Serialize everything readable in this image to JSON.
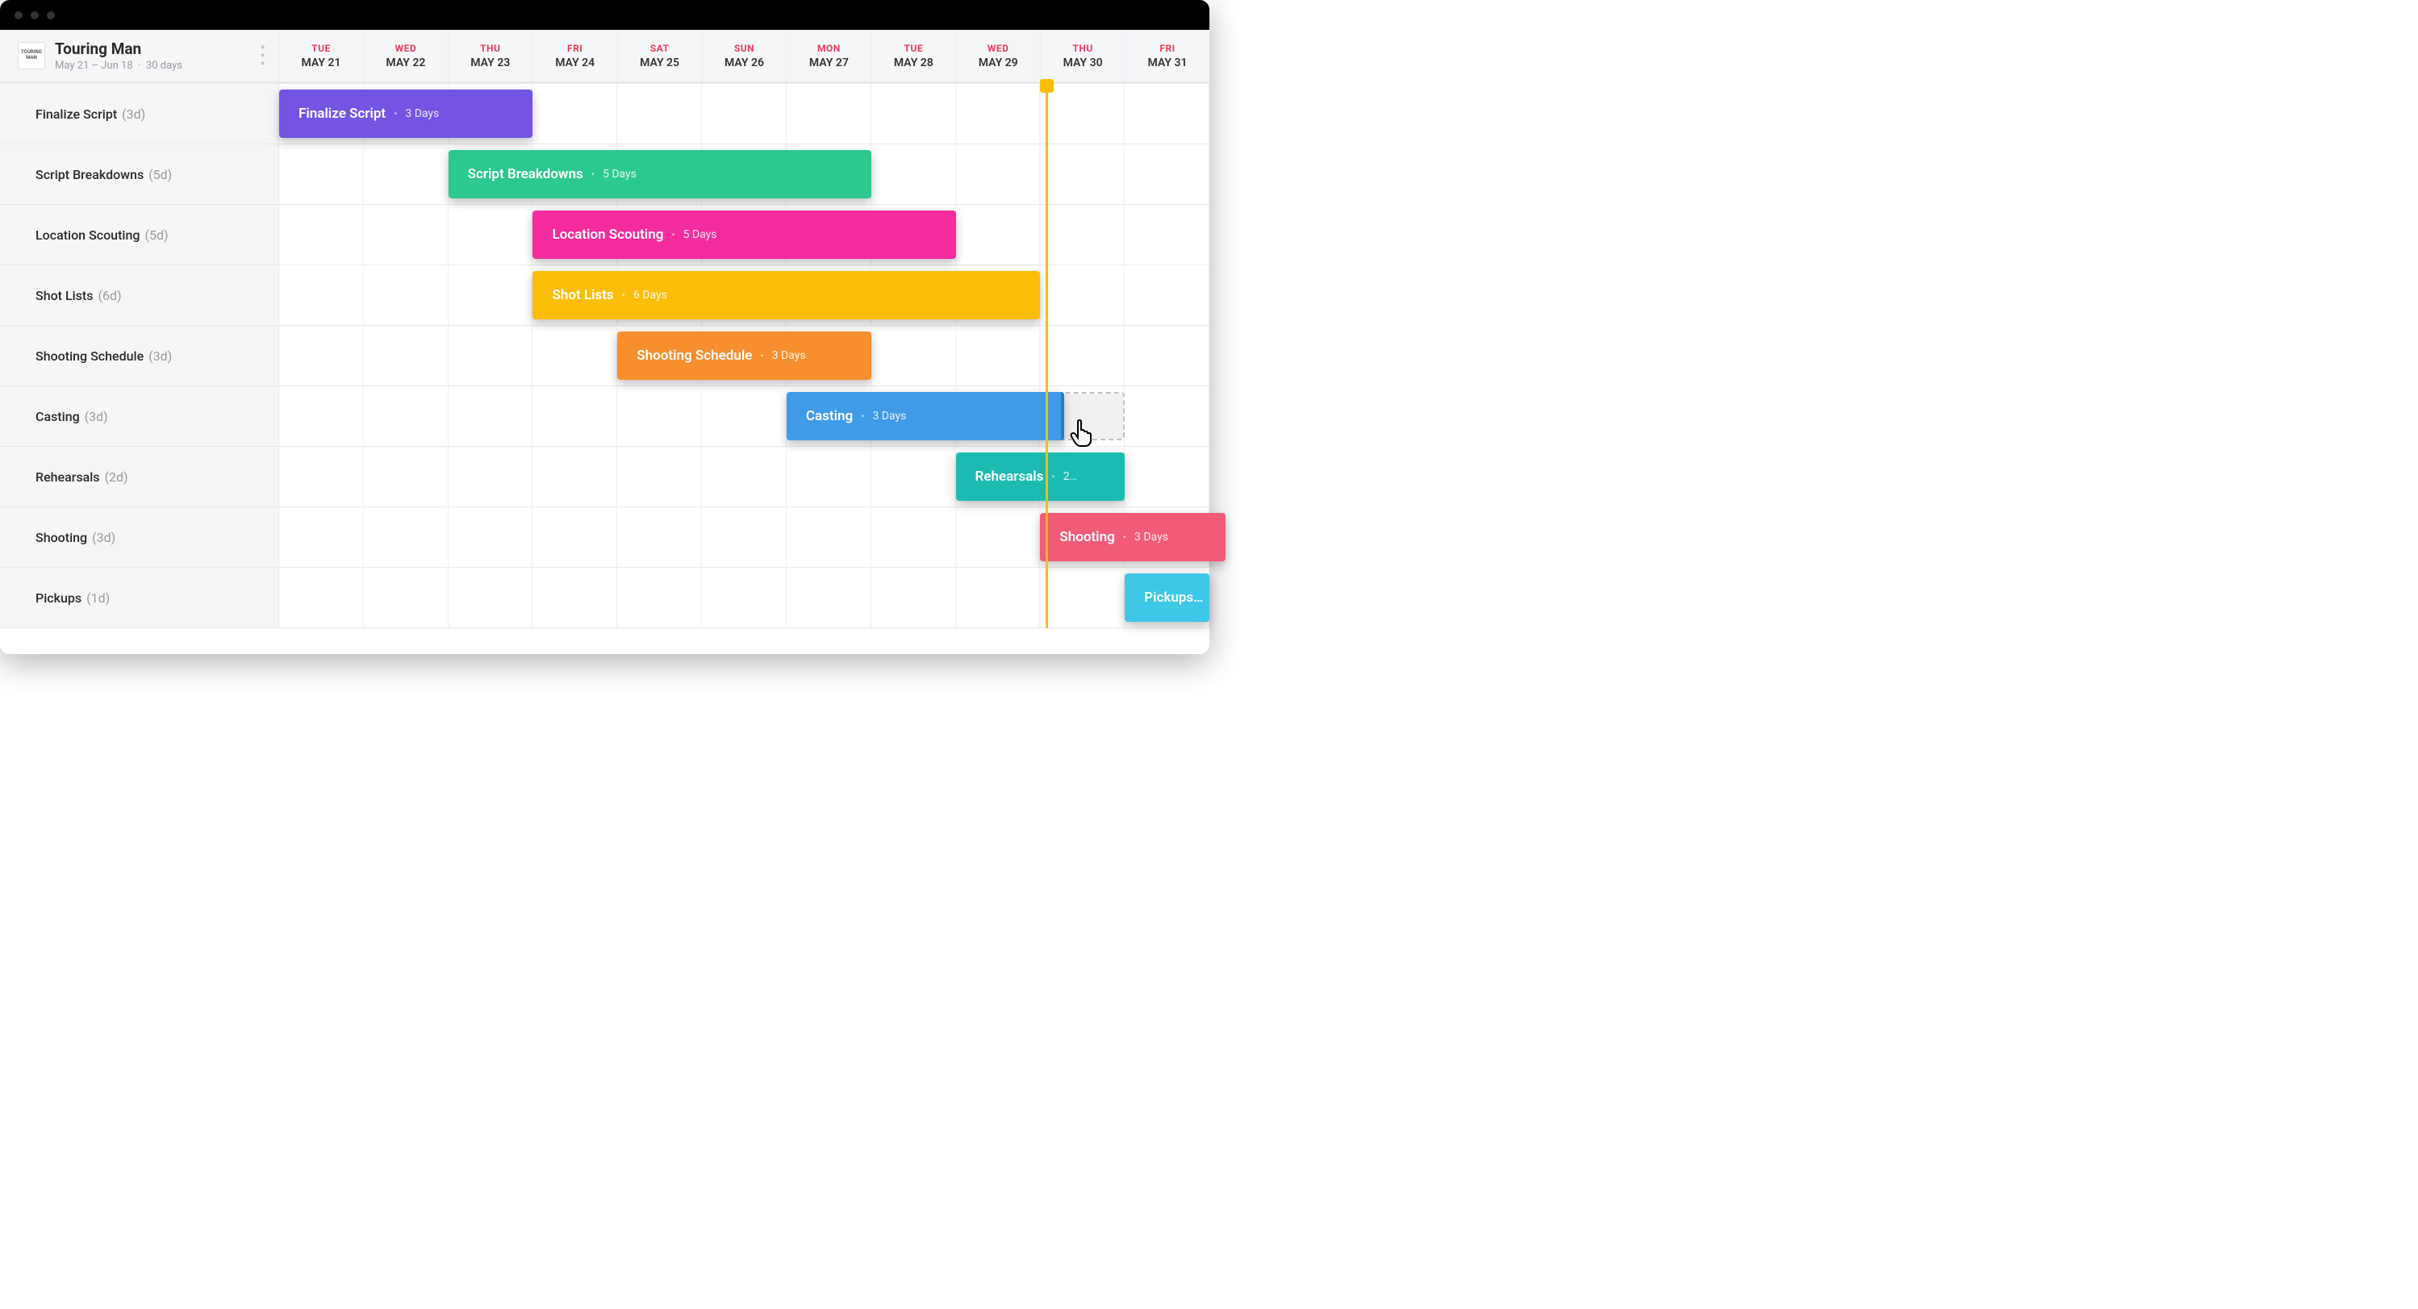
{
  "project": {
    "logo_text": "TOURING MAN",
    "title": "Touring Man",
    "date_range": "May 21 – Jun 18",
    "duration": "30 days"
  },
  "dates": [
    {
      "dow": "TUE",
      "label": "MAY 21"
    },
    {
      "dow": "WED",
      "label": "MAY 22"
    },
    {
      "dow": "THU",
      "label": "MAY 23"
    },
    {
      "dow": "FRI",
      "label": "MAY 24"
    },
    {
      "dow": "SAT",
      "label": "MAY 25"
    },
    {
      "dow": "SUN",
      "label": "MAY 26"
    },
    {
      "dow": "MON",
      "label": "MAY 27"
    },
    {
      "dow": "TUE",
      "label": "MAY 28"
    },
    {
      "dow": "WED",
      "label": "MAY 29"
    },
    {
      "dow": "THU",
      "label": "MAY 30"
    },
    {
      "dow": "FRI",
      "label": "MAY 31"
    }
  ],
  "tasks": [
    {
      "name": "Finalize Script",
      "dur_short": "(3d)",
      "bar_label": "Finalize Script",
      "bar_dur": "3 Days",
      "color": "purple",
      "start": 0,
      "span": 3
    },
    {
      "name": "Script Breakdowns",
      "dur_short": "(5d)",
      "bar_label": "Script Breakdowns",
      "bar_dur": "5 Days",
      "color": "green",
      "start": 2,
      "span": 5
    },
    {
      "name": "Location Scouting",
      "dur_short": "(5d)",
      "bar_label": "Location Scouting",
      "bar_dur": "5 Days",
      "color": "pink",
      "start": 3,
      "span": 5
    },
    {
      "name": "Shot Lists",
      "dur_short": "(6d)",
      "bar_label": "Shot Lists",
      "bar_dur": "6 Days",
      "color": "yellow",
      "start": 3,
      "span": 6
    },
    {
      "name": "Shooting Schedule",
      "dur_short": "(3d)",
      "bar_label": "Shooting Schedule",
      "bar_dur": "3 Days",
      "color": "orange",
      "start": 4,
      "span": 3
    },
    {
      "name": "Casting",
      "dur_short": "(3d)",
      "bar_label": "Casting",
      "bar_dur": "3 Days",
      "color": "blue",
      "start": 6,
      "span": 3.28,
      "dragging": true,
      "ghost_start": 6,
      "ghost_span": 4
    },
    {
      "name": "Rehearsals",
      "dur_short": "(2d)",
      "bar_label": "Rehearsals",
      "bar_dur": "2…",
      "color": "teal",
      "start": 8,
      "span": 2
    },
    {
      "name": "Shooting",
      "dur_short": "(3d)",
      "bar_label": "Shooting",
      "bar_dur": "3 Days",
      "color": "red",
      "start": 9,
      "span": 3
    },
    {
      "name": "Pickups",
      "dur_short": "(1d)",
      "bar_label": "Pickups…",
      "bar_dur": "",
      "color": "lightblue",
      "start": 10,
      "span": 1
    }
  ],
  "today_col": 9.06,
  "cursor": {
    "row": 5,
    "col": 9.38
  }
}
